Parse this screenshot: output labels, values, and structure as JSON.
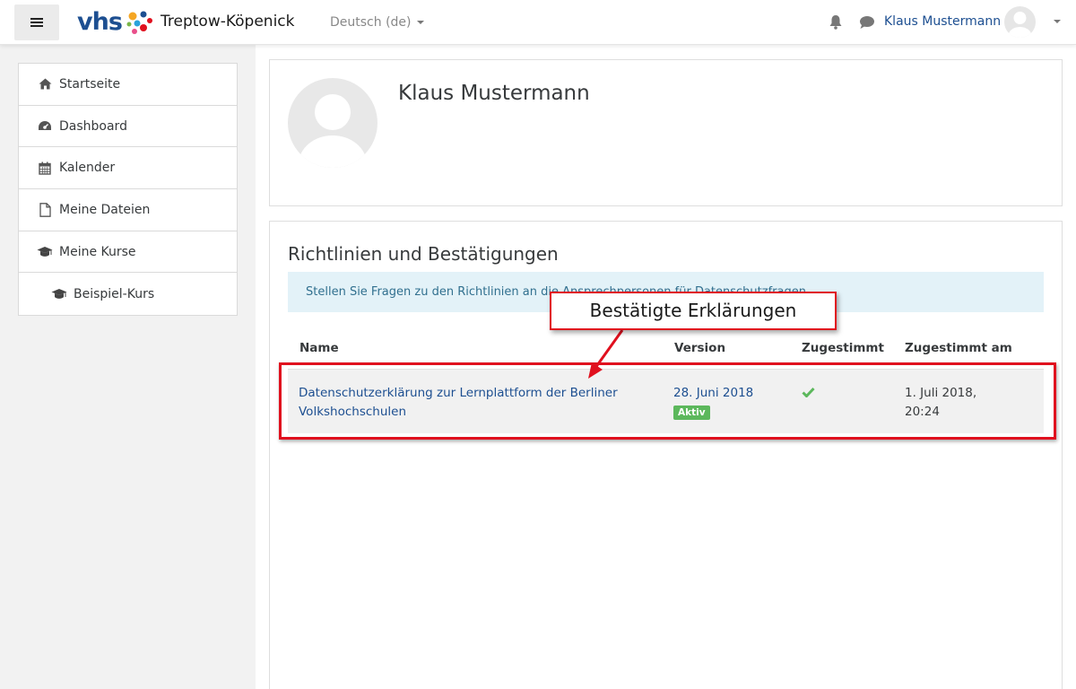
{
  "navbar": {
    "logo_text": "vhs",
    "site_name": "Treptow-Köpenick",
    "language": "Deutsch (de)",
    "user_name": "Klaus Mustermann"
  },
  "sidebar": {
    "items": [
      {
        "label": "Startseite",
        "icon": "home-icon"
      },
      {
        "label": "Dashboard",
        "icon": "dashboard-icon"
      },
      {
        "label": "Kalender",
        "icon": "calendar-icon"
      },
      {
        "label": "Meine Dateien",
        "icon": "file-icon"
      },
      {
        "label": "Meine Kurse",
        "icon": "graduation-cap-icon"
      },
      {
        "label": "Beispiel-Kurs",
        "icon": "graduation-cap-icon"
      }
    ]
  },
  "profile": {
    "name": "Klaus Mustermann"
  },
  "policies": {
    "title": "Richtlinien und Bestätigungen",
    "info_text": "Stellen Sie Fragen zu den Richtlinien an die Ansprechpersonen für Datenschutzfragen",
    "columns": [
      "Name",
      "Version",
      "Zugestimmt",
      "Zugestimmt am"
    ],
    "rows": [
      {
        "name": "Datenschutzerklärung zur Lernplattform der Berliner Volkshochschulen",
        "version": "28. Juni 2018",
        "status": "Aktiv",
        "agreed_icon": "check-icon",
        "agreed_on": "1. Juli 2018, 20:24"
      }
    ]
  },
  "annotation": {
    "callout_text": "Bestätigte Erklärungen",
    "color": "#e0101e"
  },
  "colors": {
    "brand_blue": "#1d4f91",
    "success_green": "#5cb85c",
    "info_bg": "#e3f2f8"
  }
}
